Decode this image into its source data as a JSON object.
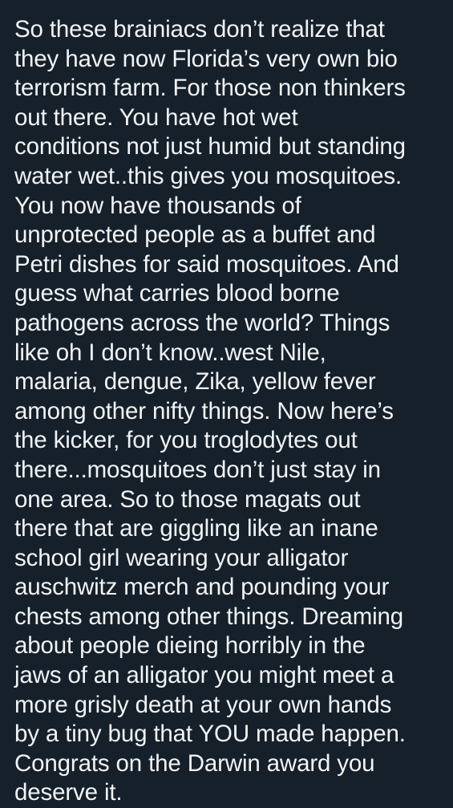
{
  "post": {
    "lines": [
      "So these brainiacs don’t realize that",
      "they have now Florida’s very own bio",
      "terrorism farm. For those non thinkers",
      "out there. You have hot wet",
      "conditions not just humid but standing",
      "water wet..this gives you mosquitoes.",
      "You now have thousands of",
      "unprotected people as a buffet and",
      "Petri dishes for said mosquitoes. And",
      "guess what carries blood borne",
      "pathogens across the world? Things",
      "like oh I don’t know..west Nile,",
      "malaria, dengue, Zika, yellow fever",
      "among other nifty things. Now here’s",
      "the kicker, for you troglodytes out",
      "there...mosquitoes don’t just stay in",
      "one area. So to those magats out",
      "there that are giggling like an inane",
      "school girl wearing your alligator",
      "auschwitz merch and pounding your",
      "chests among other things. Dreaming",
      "about people dieing horribly in the",
      "jaws of an alligator you might meet a",
      "more grisly death at your own hands",
      "by a tiny bug that YOU made happen.",
      "Congrats on the Darwin award you",
      "deserve it."
    ]
  },
  "colors": {
    "background": "#15202b",
    "text": "#f2f3f5"
  }
}
